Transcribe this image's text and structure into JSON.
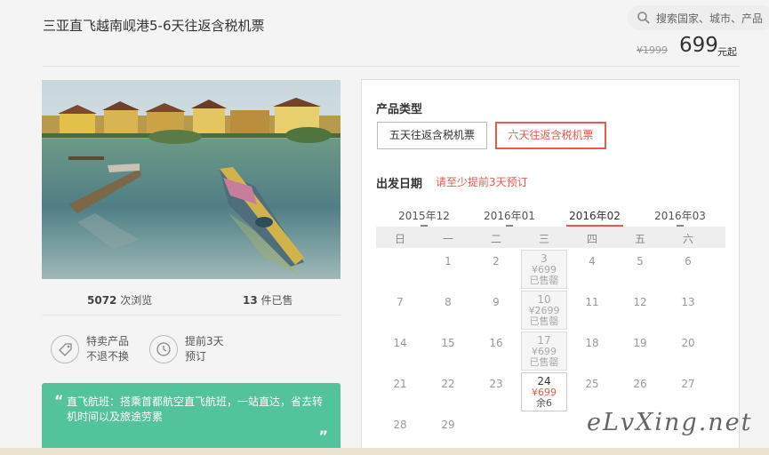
{
  "header": {
    "title": "三亚直飞越南岘港5-6天往返含税机票",
    "search_placeholder": "搜索国家、城市、产品",
    "price_old": "¥1999",
    "price_new": "699",
    "price_unit": "元起"
  },
  "stats": {
    "views_count": "5072",
    "views_label": "次浏览",
    "sold_count": "13",
    "sold_label": "件已售"
  },
  "features": [
    {
      "line1": "特卖产品",
      "line2": "不退不换",
      "icon": "tag-icon"
    },
    {
      "line1": "提前3天",
      "line2": "预订",
      "icon": "clock-icon"
    }
  ],
  "promo": {
    "text": "直飞航班：搭乘首都航空直飞航班，一站直达，省去转机时间以及旅途劳累",
    "open_quote": "“",
    "close_quote": "”"
  },
  "panel": {
    "product_type_label": "产品类型",
    "products": [
      "五天往返含税机票",
      "六天往返含税机票"
    ],
    "selected_product": "六天往返含税机票",
    "date_label": "出发日期",
    "date_hint": "请至少提前3天预订",
    "months": [
      "2015年12",
      "2016年01",
      "2016年02",
      "2016年03"
    ],
    "selected_month": "2016年02",
    "weekdays": [
      "日",
      "一",
      "二",
      "三",
      "四",
      "五",
      "六"
    ],
    "days": [
      {
        "day": "1"
      },
      {
        "day": "2"
      },
      {
        "day": "3",
        "price": "¥699",
        "status": "已售罄"
      },
      {
        "day": "4"
      },
      {
        "day": "5"
      },
      {
        "day": "6"
      },
      {
        "day": "7"
      },
      {
        "day": "8"
      },
      {
        "day": "9"
      },
      {
        "day": "10",
        "price": "¥2699",
        "status": "已售罄"
      },
      {
        "day": "11"
      },
      {
        "day": "12"
      },
      {
        "day": "13"
      },
      {
        "day": "14"
      },
      {
        "day": "15"
      },
      {
        "day": "16"
      },
      {
        "day": "17",
        "price": "¥699",
        "status": "已售罄"
      },
      {
        "day": "18"
      },
      {
        "day": "19"
      },
      {
        "day": "20"
      },
      {
        "day": "21"
      },
      {
        "day": "22"
      },
      {
        "day": "23"
      },
      {
        "day": "24",
        "price": "¥699",
        "status": "余6"
      },
      {
        "day": "25"
      },
      {
        "day": "26"
      },
      {
        "day": "27"
      },
      {
        "day": "28"
      },
      {
        "day": "29"
      }
    ]
  },
  "watermark": "eLvXing.net",
  "colors": {
    "accent": "#e75a4e",
    "promo_green": "#53c39c"
  }
}
